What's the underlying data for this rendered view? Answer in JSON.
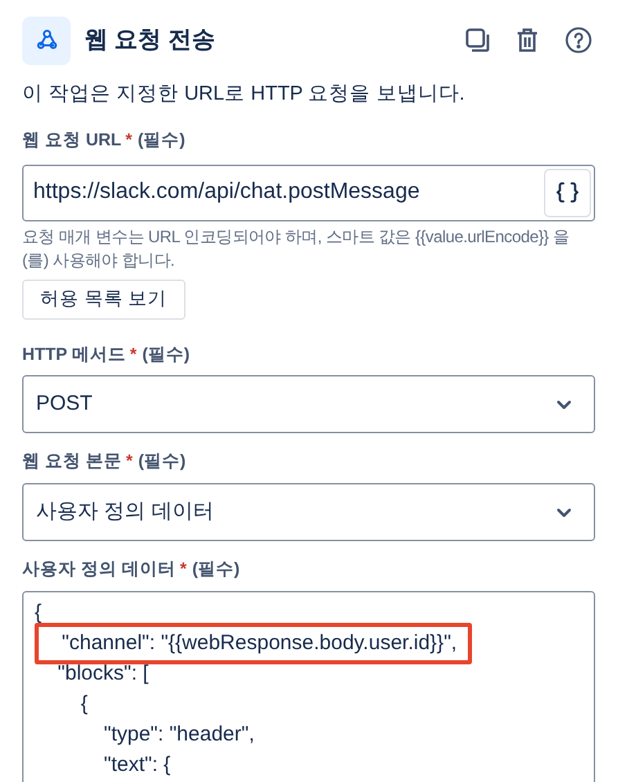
{
  "header": {
    "title": "웹 요청 전송",
    "actions": [
      {
        "kind": "copy"
      },
      {
        "kind": "delete"
      },
      {
        "kind": "help"
      }
    ]
  },
  "description": "이 작업은 지정한 URL로 HTTP 요청을 보냅니다.",
  "url_field": {
    "label": "웹 요청 URL",
    "required_mark": "*",
    "required_text": "(필수)",
    "value": "https://slack.com/api/chat.postMessage",
    "help": "요청 매개 변수는 URL 인코딩되어야 하며, 스마트 값은 {{value.urlEncode}} 을(를) 사용해야 합니다.",
    "button": "허용 목록 보기"
  },
  "method_field": {
    "label": "HTTP 메서드",
    "required_mark": "*",
    "required_text": "(필수)",
    "value": "POST"
  },
  "body_field": {
    "label": "웹 요청 본문",
    "required_mark": "*",
    "required_text": "(필수)",
    "value": "사용자 정의 데이터"
  },
  "custom_data": {
    "label": "사용자 정의 데이터",
    "required_mark": "*",
    "required_text": "(필수)",
    "lines": [
      {
        "text": "{",
        "highlighted": false
      },
      {
        "text": "    \"channel\": \"{{webResponse.body.user.id}}\",",
        "highlighted": true
      },
      {
        "text": "    \"blocks\": [",
        "highlighted": false
      },
      {
        "text": "        {",
        "highlighted": false
      },
      {
        "text": "            \"type\": \"header\",",
        "highlighted": false
      },
      {
        "text": "            \"text\": {",
        "highlighted": false
      }
    ]
  }
}
